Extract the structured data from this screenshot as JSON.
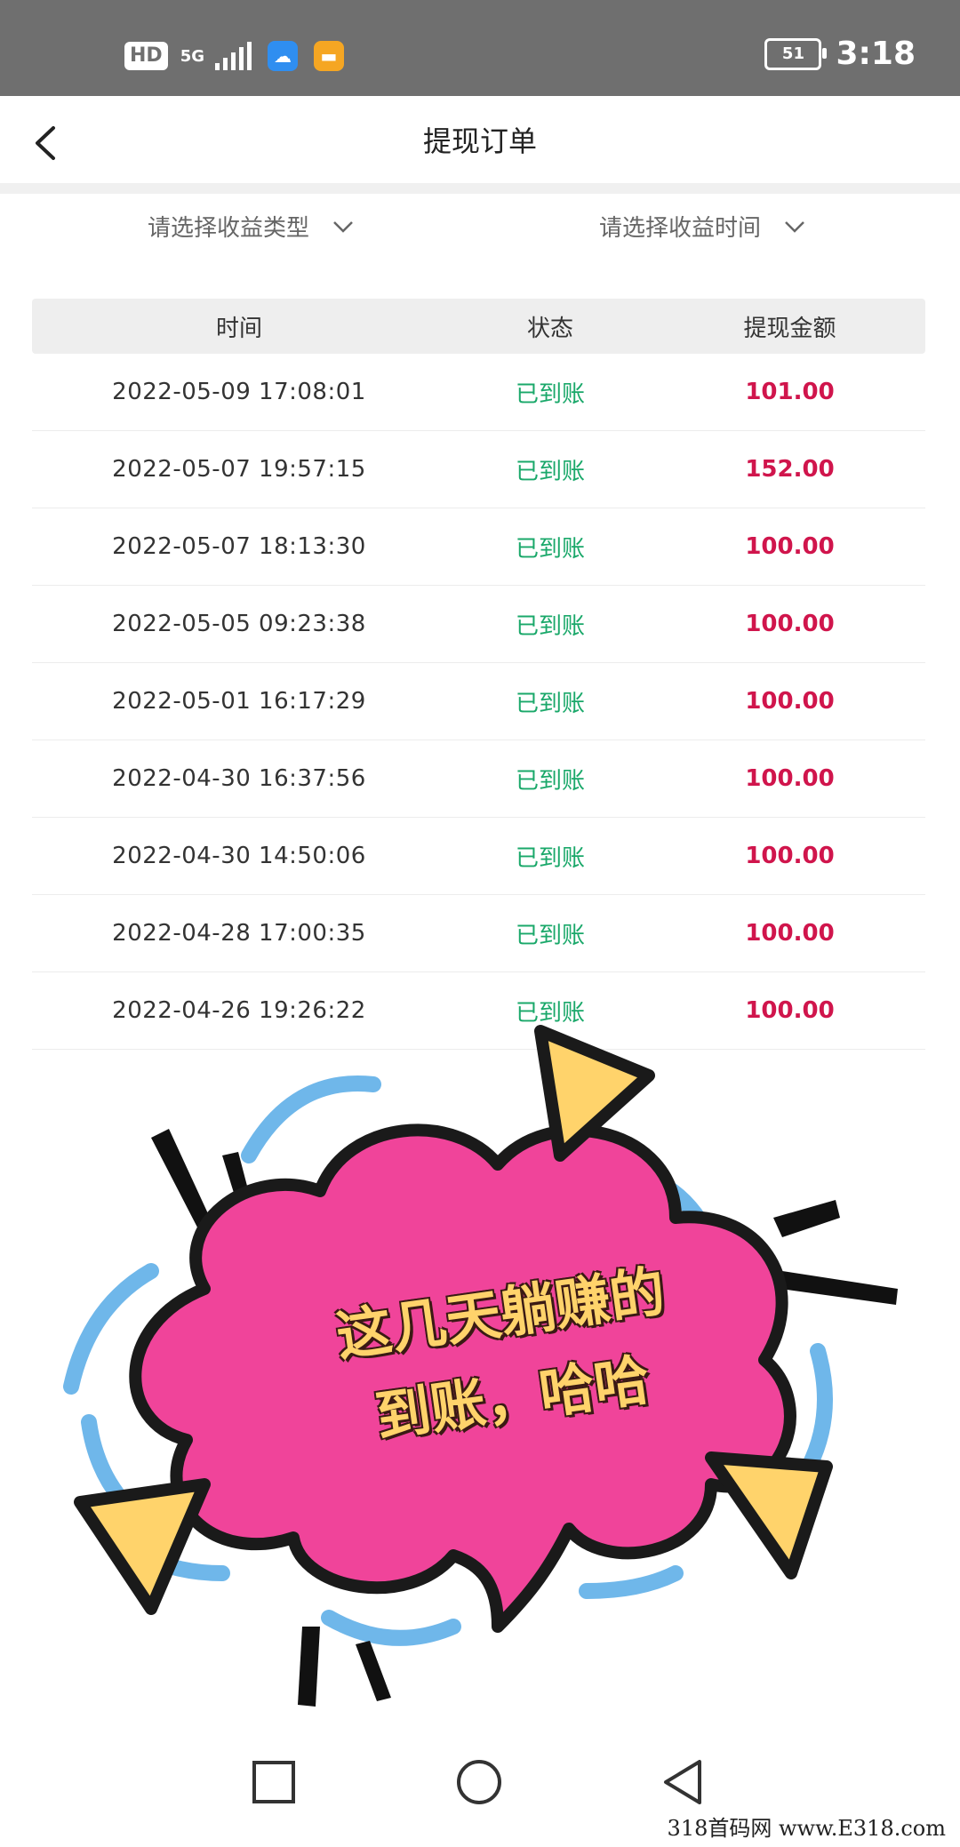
{
  "status_bar": {
    "hd_label": "HD",
    "network_label": "5G",
    "battery_level": "51",
    "time": "3:18",
    "icons": [
      "hd-icon",
      "signal-icon",
      "cloud-app-icon",
      "message-app-icon",
      "battery-icon"
    ]
  },
  "header": {
    "title": "提现订单",
    "back_icon": "chevron-left-icon"
  },
  "filters": {
    "income_type": "请选择收益类型",
    "income_time": "请选择收益时间"
  },
  "table": {
    "columns": [
      "时间",
      "状态",
      "提现金额"
    ],
    "rows": [
      {
        "time": "2022-05-09 17:08:01",
        "status": "已到账",
        "amount": "101.00"
      },
      {
        "time": "2022-05-07 19:57:15",
        "status": "已到账",
        "amount": "152.00"
      },
      {
        "time": "2022-05-07 18:13:30",
        "status": "已到账",
        "amount": "100.00"
      },
      {
        "time": "2022-05-05 09:23:38",
        "status": "已到账",
        "amount": "100.00"
      },
      {
        "time": "2022-05-01 16:17:29",
        "status": "已到账",
        "amount": "100.00"
      },
      {
        "time": "2022-04-30 16:37:56",
        "status": "已到账",
        "amount": "100.00"
      },
      {
        "time": "2022-04-30 14:50:06",
        "status": "已到账",
        "amount": "100.00"
      },
      {
        "time": "2022-04-28 17:00:35",
        "status": "已到账",
        "amount": "100.00"
      },
      {
        "time": "2022-04-26 19:26:22",
        "status": "已到账",
        "amount": "100.00"
      }
    ]
  },
  "promo": {
    "line1": "这几天躺赚的",
    "line2": "到账，哈哈"
  },
  "nav": {
    "icons": [
      "recent-apps-icon",
      "home-icon",
      "back-triangle-icon"
    ]
  },
  "watermark": "318首码网 www.E318.com",
  "colors": {
    "status_bar": "#6f6f6f",
    "status_green": "#1aa86a",
    "amount_red": "#d0154c",
    "bubble_pink": "#f0449a",
    "accent_yellow": "#ffd36b",
    "splash_blue": "#6fb7ea"
  }
}
